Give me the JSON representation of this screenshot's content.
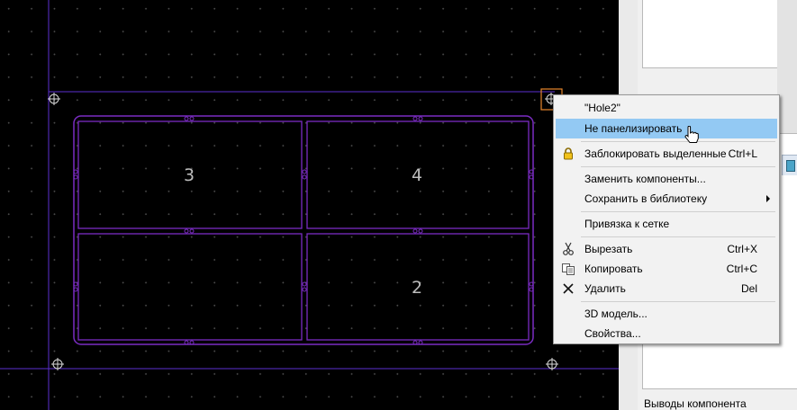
{
  "board": {
    "panel_labels": [
      "3",
      "4",
      "2"
    ]
  },
  "context_menu": {
    "items": [
      {
        "label": "\"Hole2\"",
        "shortcut": ""
      },
      {
        "label": "Не панелизировать",
        "shortcut": "",
        "highlighted": true
      },
      {
        "label": "Заблокировать выделенные",
        "shortcut": "Ctrl+L",
        "icon": "lock-icon"
      },
      {
        "label": "Заменить компоненты...",
        "shortcut": ""
      },
      {
        "label": "Сохранить в библиотеку",
        "shortcut": "",
        "submenu": true
      },
      {
        "label": "Привязка к сетке",
        "shortcut": ""
      },
      {
        "label": "Вырезать",
        "shortcut": "Ctrl+X",
        "icon": "scissors-icon"
      },
      {
        "label": "Копировать",
        "shortcut": "Ctrl+C",
        "icon": "copy-icon"
      },
      {
        "label": "Удалить",
        "shortcut": "Del",
        "icon": "delete-x-icon"
      },
      {
        "label": "3D модель...",
        "shortcut": ""
      },
      {
        "label": "Свойства...",
        "shortcut": ""
      }
    ]
  },
  "right_panel": {
    "caption": "Выводы компонента"
  },
  "colors": {
    "canvas": "#000000",
    "grid_dots": "#4a4a4a",
    "board_outline": "#7a2cc2",
    "guide_lines": "#5b2fd0",
    "selection": "#e8872b",
    "menu_highlight": "#93c9f3"
  }
}
